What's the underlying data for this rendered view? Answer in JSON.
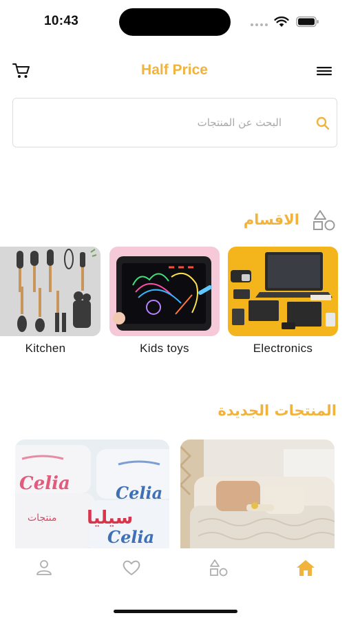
{
  "status_bar": {
    "time": "10:43",
    "icons": [
      "signal-dots-icon",
      "wifi-icon",
      "battery-icon"
    ]
  },
  "header": {
    "title": "Half Price",
    "cart_icon": "cart-icon",
    "menu_icon": "hamburger-menu-icon"
  },
  "search": {
    "placeholder": "البحث عن المنتجات",
    "value": "",
    "icon": "search-icon"
  },
  "categories_section": {
    "title": "الاقسام",
    "icon": "shapes-icon",
    "items": [
      {
        "label": "Electronics",
        "image": "electronics-photo"
      },
      {
        "label": "Kids toys",
        "image": "drawing-tablet-photo"
      },
      {
        "label": "Kitchen",
        "image": "kitchen-utensils-photo"
      }
    ]
  },
  "new_products_section": {
    "title": "المنتجات الجديدة",
    "items": [
      {
        "image": "sofa-cover-photo"
      },
      {
        "image": "celia-product-photo",
        "visible_text": [
          "Celia",
          "سيليا",
          "منتجات"
        ]
      }
    ]
  },
  "bottom_nav": {
    "items": [
      {
        "icon": "home-icon",
        "active": true
      },
      {
        "icon": "categories-icon",
        "active": false
      },
      {
        "icon": "heart-icon",
        "active": false
      },
      {
        "icon": "profile-icon",
        "active": false
      }
    ]
  },
  "colors": {
    "accent": "#F2B33D",
    "inactive_icon": "#AFAFAF",
    "border": "#DEDEDE",
    "text": "#1C1C1C"
  }
}
